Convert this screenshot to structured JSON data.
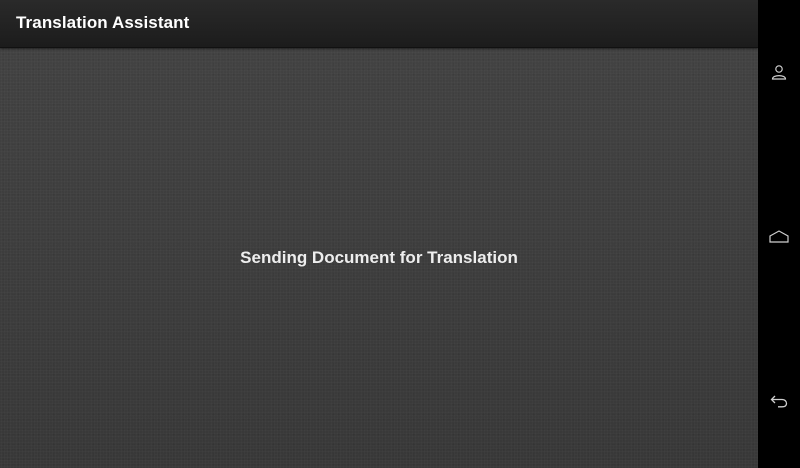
{
  "app": {
    "title": "Translation Assistant"
  },
  "content": {
    "status_message": "Sending Document for Translation"
  },
  "nav": {
    "buttons": [
      {
        "icon": "profile-icon"
      },
      {
        "icon": "home-icon"
      },
      {
        "icon": "back-icon"
      }
    ]
  },
  "colors": {
    "background": "#3d3d3d",
    "action_bar": "#222222",
    "nav_bar": "#000000",
    "text": "#ffffff"
  }
}
